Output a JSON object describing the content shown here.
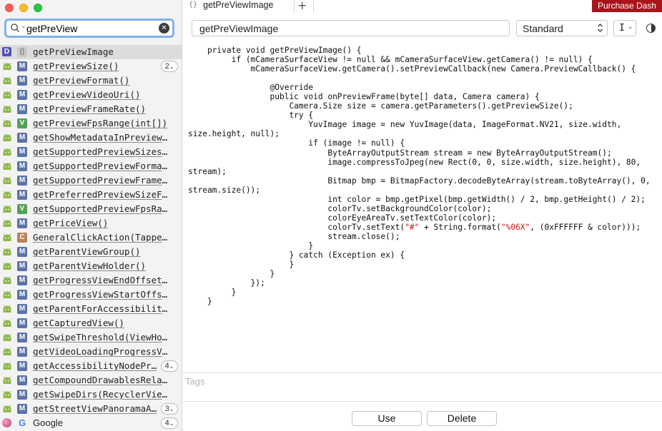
{
  "search": {
    "value": "getPreView"
  },
  "results": [
    {
      "source": "dash",
      "kind": "{}",
      "kind_style": "curly",
      "label": "getPreViewImage",
      "selected": true
    },
    {
      "source": "android",
      "kind": "M",
      "label": "getPreviewSize()",
      "count": "2"
    },
    {
      "source": "android",
      "kind": "M",
      "label": "getPreviewFormat()"
    },
    {
      "source": "android",
      "kind": "M",
      "label": "getPreviewVideoUri()"
    },
    {
      "source": "android",
      "kind": "M",
      "label": "getPreviewFrameRate()"
    },
    {
      "source": "android",
      "kind": "V",
      "label": "getPreviewFpsRange(int[])"
    },
    {
      "source": "android",
      "kind": "M",
      "label": "getShowMetadataInPreview()"
    },
    {
      "source": "android",
      "kind": "M",
      "label": "getSupportedPreviewSizes()"
    },
    {
      "source": "android",
      "kind": "M",
      "label": "getSupportedPreviewFormat…"
    },
    {
      "source": "android",
      "kind": "M",
      "label": "getSupportedPreviewFrameR…"
    },
    {
      "source": "android",
      "kind": "M",
      "label": "getPreferredPreviewSizeFo…"
    },
    {
      "source": "android",
      "kind": "V",
      "label": "getSupportedPreviewFpsRan…"
    },
    {
      "source": "android",
      "kind": "M",
      "label": "getPriceView()"
    },
    {
      "source": "android",
      "kind": "C",
      "label": "GeneralClickAction(Tapper…"
    },
    {
      "source": "android",
      "kind": "M",
      "label": "getParentViewGroup()"
    },
    {
      "source": "android",
      "kind": "M",
      "label": "getParentViewHolder()"
    },
    {
      "source": "android",
      "kind": "M",
      "label": "getProgressViewEndOffset()"
    },
    {
      "source": "android",
      "kind": "M",
      "label": "getProgressViewStartOffse…"
    },
    {
      "source": "android",
      "kind": "M",
      "label": "getParentForAccessibility…"
    },
    {
      "source": "android",
      "kind": "M",
      "label": "getCapturedView()"
    },
    {
      "source": "android",
      "kind": "M",
      "label": "getSwipeThreshold(ViewHol…"
    },
    {
      "source": "android",
      "kind": "M",
      "label": "getVideoLoadingProgressVi…"
    },
    {
      "source": "android",
      "kind": "M",
      "label": "getAccessibilityNodePr…",
      "count": "4"
    },
    {
      "source": "android",
      "kind": "M",
      "label": "getCompoundDrawablesRelat…"
    },
    {
      "source": "android",
      "kind": "M",
      "label": "getSwipeDirs(RecyclerView…"
    },
    {
      "source": "android",
      "kind": "M",
      "label": "getStreetViewPanoramaA…",
      "count": "3"
    },
    {
      "source": "ball",
      "kind": "G",
      "label": "Google",
      "count": "4",
      "plain": true
    }
  ],
  "tabs": {
    "active_label": "getPreViewImage",
    "active_icon": "{}",
    "add_label": "+"
  },
  "purchase_label": "Purchase Dash",
  "toolbar": {
    "title_value": "getPreViewImage",
    "platform_label": "Standard",
    "cursor_glyph": "I"
  },
  "code_lines": [
    "    private void getPreViewImage() {",
    "         if (mCameraSurfaceView != null && mCameraSurfaceView.getCamera() != null) {",
    "             mCameraSurfaceView.getCamera().setPreviewCallback(new Camera.PreviewCallback() {",
    "",
    "                 @Override",
    "                 public void onPreviewFrame(byte[] data, Camera camera) {",
    "                     Camera.Size size = camera.getParameters().getPreviewSize();",
    "                     try {",
    "                         YuvImage image = new YuvImage(data, ImageFormat.NV21, size.width,",
    "size.height, null);",
    "                         if (image != null) {",
    "                             ByteArrayOutputStream stream = new ByteArrayOutputStream();",
    "                             image.compressToJpeg(new Rect(0, 0, size.width, size.height), 80,",
    "stream);",
    "                             Bitmap bmp = BitmapFactory.decodeByteArray(stream.toByteArray(), 0,",
    "stream.size());",
    "                             int color = bmp.getPixel(bmp.getWidth() / 2, bmp.getHeight() / 2);",
    "                             colorTv.setBackgroundColor(color);",
    "                             colorEyeAreaTv.setTextColor(color);",
    "                             colorTv.setText(\"#\" + String.format(\"%06X\", (0xFFFFFF & color)));",
    "                             stream.close();",
    "                         }",
    "                     } catch (Exception ex) {",
    "                     }",
    "                 }",
    "             });",
    "         }",
    "    }"
  ],
  "tags_placeholder": "Tags",
  "buttons": {
    "use": "Use",
    "delete": "Delete"
  },
  "colors": {
    "purchase_bg": "#a9141b",
    "search_focus": "#7fb0ee",
    "string_literal": "#c41a16"
  }
}
